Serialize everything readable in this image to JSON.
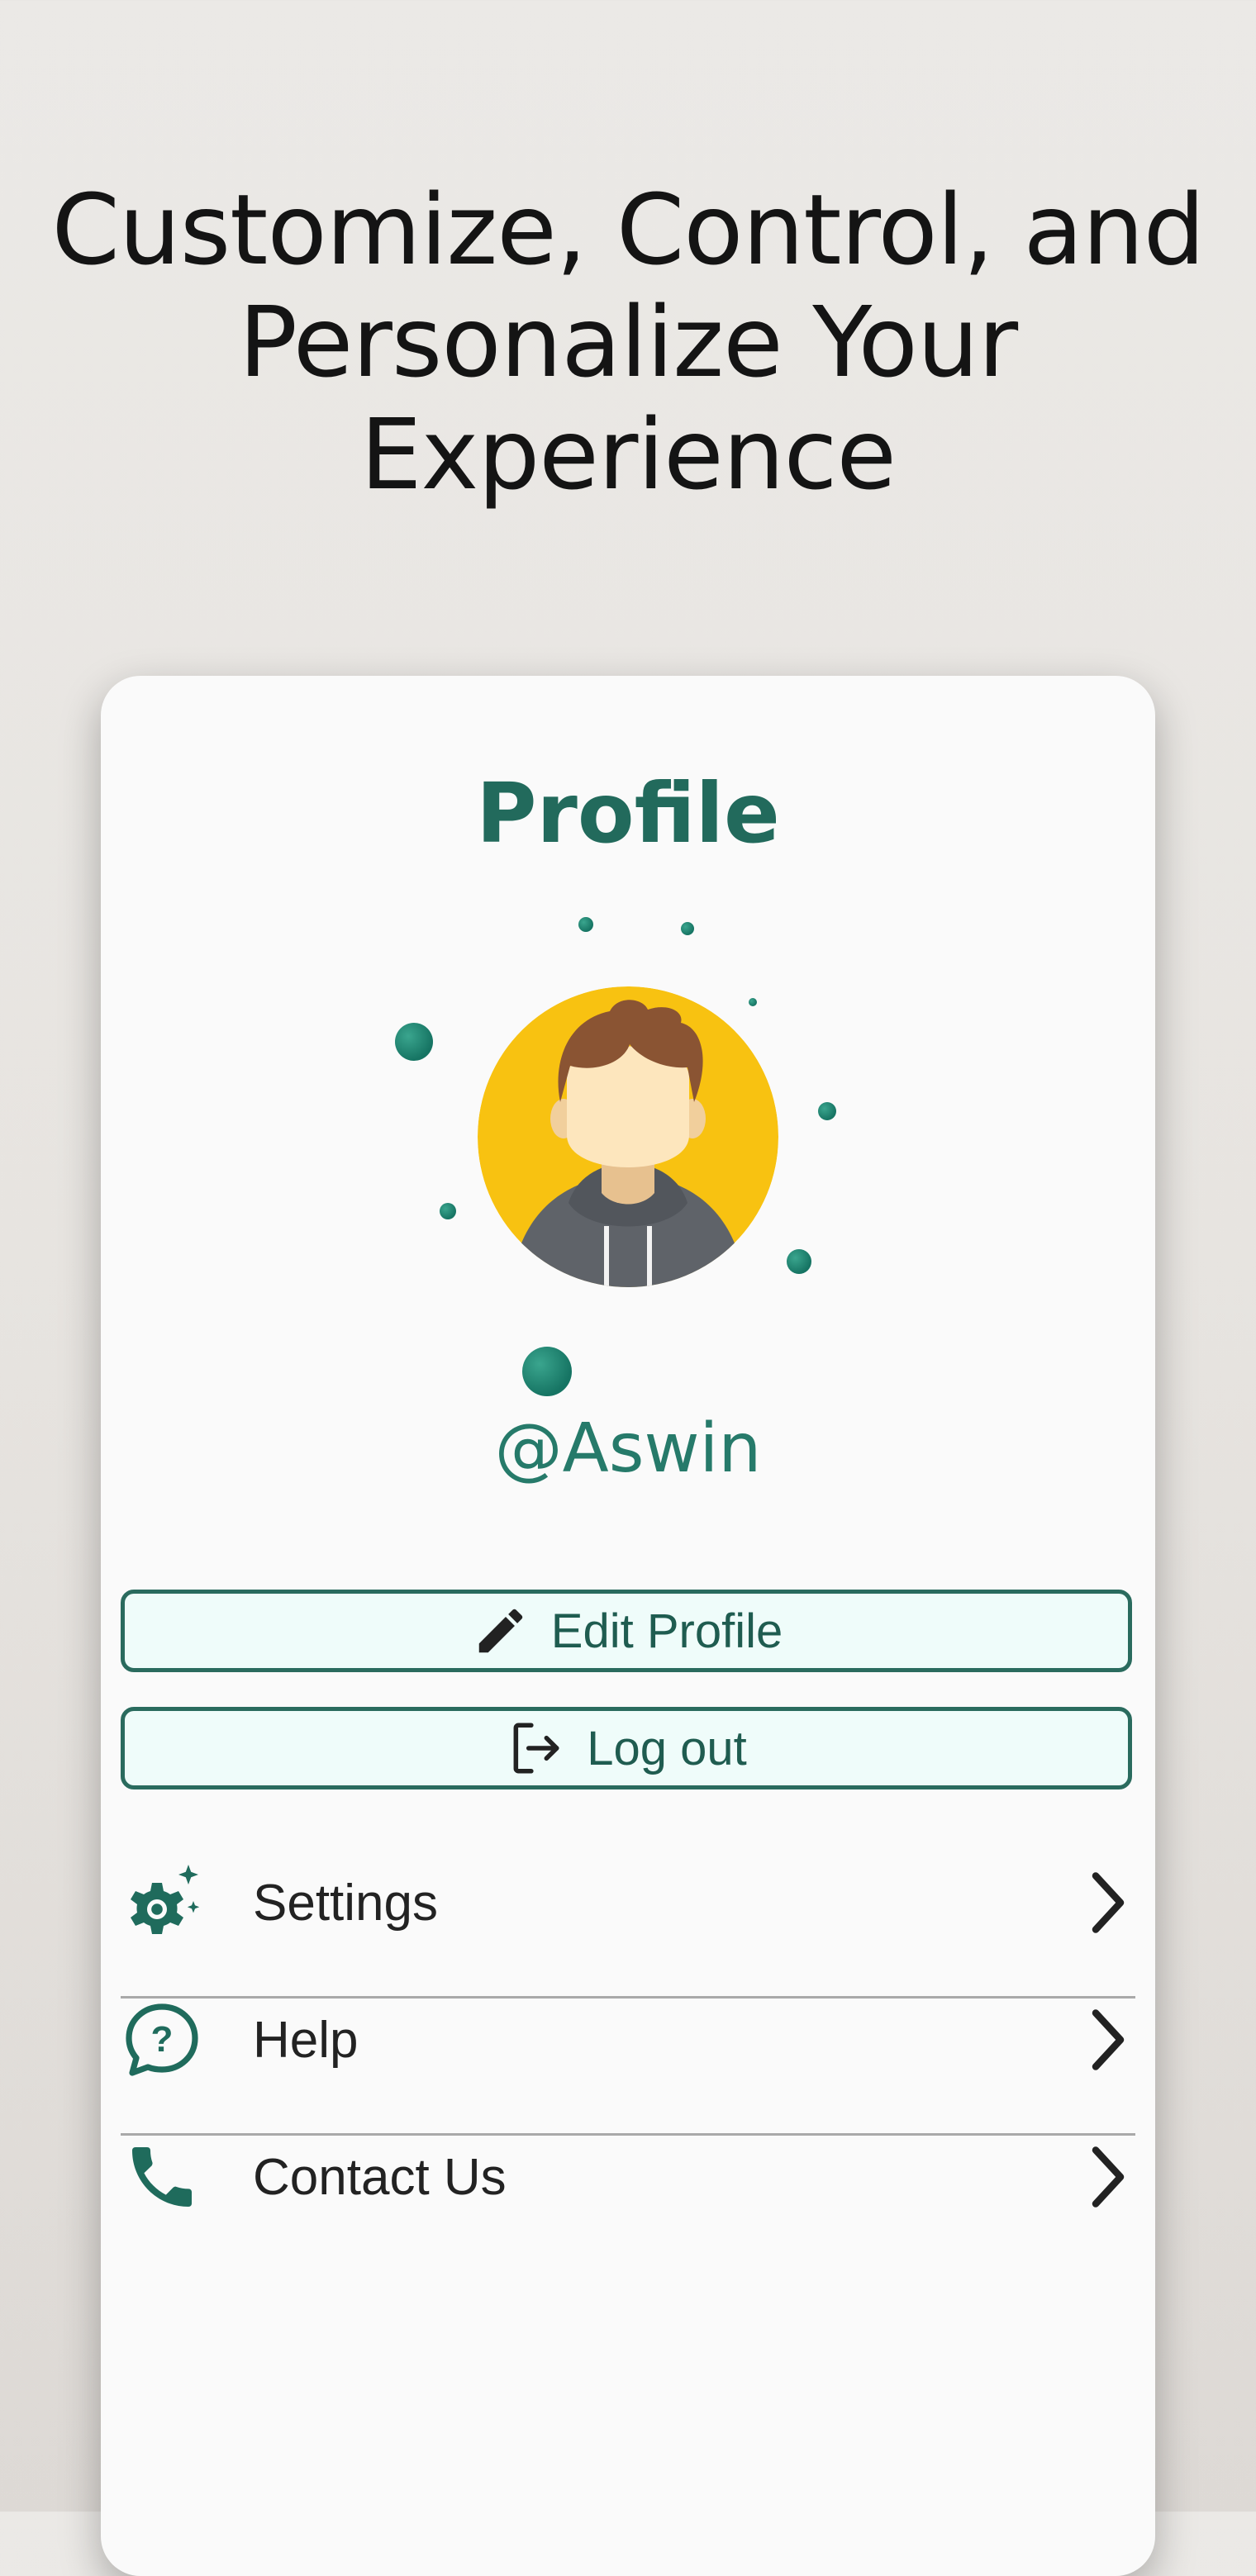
{
  "headline": {
    "line1": "Customize, Control, and",
    "line2": "Personalize Your",
    "line3": "Experience"
  },
  "profile": {
    "title": "Profile",
    "username": "@Aswin",
    "edit_button": "Edit Profile",
    "logout_button": "Log out"
  },
  "menu": {
    "items": [
      {
        "label": "Settings",
        "icon": "settings-sparkle-icon"
      },
      {
        "label": "Help",
        "icon": "help-chat-icon"
      },
      {
        "label": "Contact Us",
        "icon": "phone-icon"
      }
    ]
  },
  "colors": {
    "accent": "#226a5c",
    "button_bg": "#effcfa",
    "avatar_bg": "#f8c211"
  }
}
